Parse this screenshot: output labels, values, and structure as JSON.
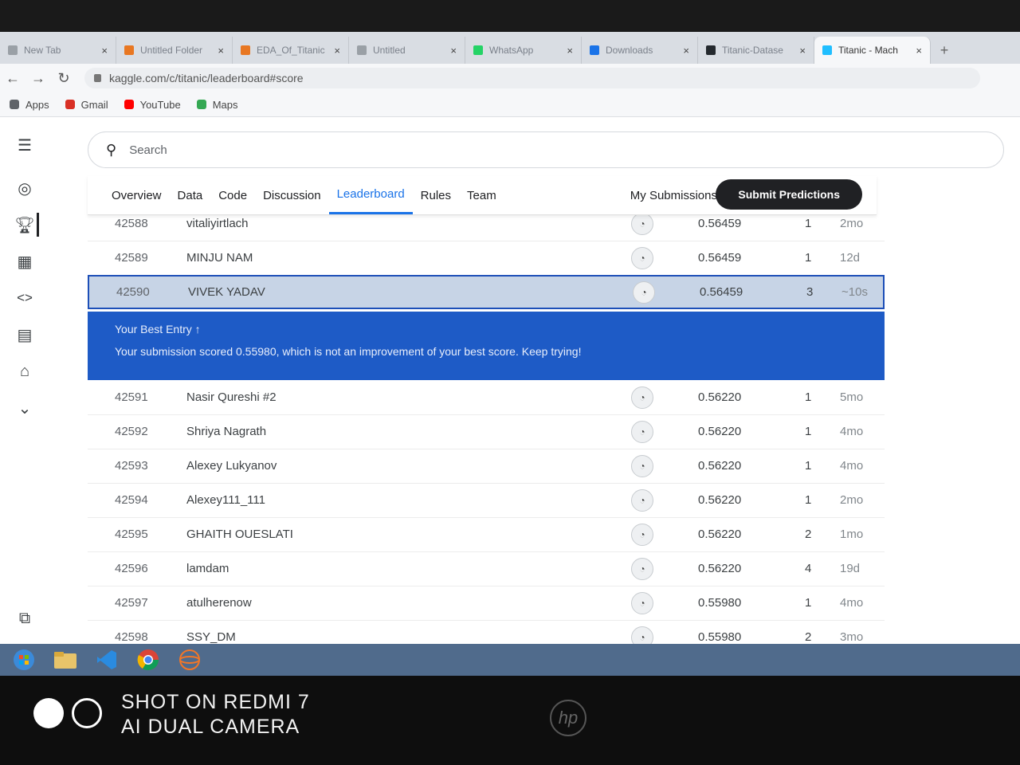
{
  "browser": {
    "tabs": [
      {
        "label": "New Tab",
        "icon": "blank-icon",
        "color": "#9aa0a6"
      },
      {
        "label": "Untitled Folder",
        "icon": "jupyter-icon",
        "color": "#e87722"
      },
      {
        "label": "EDA_Of_Titanic",
        "icon": "jupyter-icon",
        "color": "#e87722"
      },
      {
        "label": "Untitled",
        "icon": "blank-icon",
        "color": "#9aa0a6"
      },
      {
        "label": "WhatsApp",
        "icon": "whatsapp-icon",
        "color": "#25d366"
      },
      {
        "label": "Downloads",
        "icon": "download-icon",
        "color": "#1a73e8"
      },
      {
        "label": "Titanic-Datase",
        "icon": "github-icon",
        "color": "#24292e"
      },
      {
        "label": "Titanic - Mach",
        "icon": "kaggle-icon",
        "color": "#20beff"
      }
    ],
    "url": "kaggle.com/c/titanic/leaderboard#score",
    "bookmarks": [
      {
        "label": "Apps",
        "color": "#5f6368"
      },
      {
        "label": "Gmail",
        "color": "#d93025"
      },
      {
        "label": "YouTube",
        "color": "#ff0000"
      },
      {
        "label": "Maps",
        "color": "#34a853"
      }
    ]
  },
  "kaggle": {
    "search_placeholder": "Search",
    "tabs": [
      "Overview",
      "Data",
      "Code",
      "Discussion",
      "Leaderboard",
      "Rules",
      "Team"
    ],
    "active_tab": "Leaderboard",
    "my_submissions": "My Submissions",
    "submit_button": "Submit Predictions",
    "rows_top": [
      {
        "rank": "42588",
        "name": "vitaliyirtlach",
        "score": "0.56459",
        "entries": "1",
        "last": "2mo"
      },
      {
        "rank": "42589",
        "name": "MINJU NAM",
        "score": "0.56459",
        "entries": "1",
        "last": "12d"
      }
    ],
    "my_row": {
      "rank": "42590",
      "name": "VIVEK YADAV",
      "score": "0.56459",
      "entries": "3",
      "last": "~10s"
    },
    "best_entry": {
      "title": "Your Best Entry",
      "message": "Your submission scored 0.55980, which is not an improvement of your best score. Keep trying!"
    },
    "rows_bottom": [
      {
        "rank": "42591",
        "name": "Nasir Qureshi #2",
        "score": "0.56220",
        "entries": "1",
        "last": "5mo"
      },
      {
        "rank": "42592",
        "name": "Shriya Nagrath",
        "score": "0.56220",
        "entries": "1",
        "last": "4mo"
      },
      {
        "rank": "42593",
        "name": "Alexey Lukyanov",
        "score": "0.56220",
        "entries": "1",
        "last": "4mo"
      },
      {
        "rank": "42594",
        "name": "Alexey111_111",
        "score": "0.56220",
        "entries": "1",
        "last": "2mo"
      },
      {
        "rank": "42595",
        "name": "GHAITH OUESLATI",
        "score": "0.56220",
        "entries": "2",
        "last": "1mo"
      },
      {
        "rank": "42596",
        "name": "lamdam",
        "score": "0.56220",
        "entries": "4",
        "last": "19d"
      },
      {
        "rank": "42597",
        "name": "atulherenow",
        "score": "0.55980",
        "entries": "1",
        "last": "4mo"
      },
      {
        "rank": "42598",
        "name": "SSY_DM",
        "score": "0.55980",
        "entries": "2",
        "last": "3mo"
      }
    ]
  },
  "watermark": {
    "line1": "SHOT ON REDMI 7",
    "line2": "AI DUAL CAMERA"
  },
  "laptop_logo": "hp",
  "colors": {
    "accent": "#1a73e8",
    "best_banner": "#1e5bc6",
    "submit_bg": "#202124"
  }
}
